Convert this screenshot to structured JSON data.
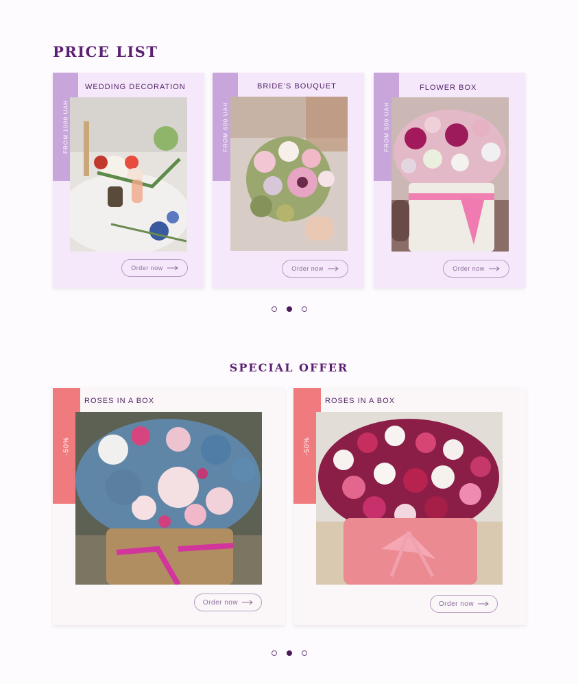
{
  "price_list": {
    "title": "PRICE LIST",
    "cards": [
      {
        "title": "WEDDING DECORATION",
        "price_tag": "FROM 1000 UAH",
        "button": "Order now"
      },
      {
        "title": "BRIDE’S BOUQUET",
        "price_tag": "FROM 600 UAH",
        "button": "Order now"
      },
      {
        "title": "FLOWER BOX",
        "price_tag": "FROM 500 UAH",
        "button": "Order now"
      }
    ],
    "pagination": {
      "count": 3,
      "active": 2
    }
  },
  "special_offer": {
    "title": "SPECIAL OFFER",
    "cards": [
      {
        "title": "ROSES IN A BOX",
        "discount": "-50%",
        "button": "Order now"
      },
      {
        "title": "ROSES IN A BOX",
        "discount": "-50%",
        "button": "Order now"
      }
    ],
    "pagination": {
      "count": 3,
      "active": 2
    }
  },
  "icons": {
    "order_arrow": "arrow-right-icon",
    "carousel_dot": "dot-icon"
  },
  "colors": {
    "title": "#5b2072",
    "price_card_bg": "#f6e8fb",
    "price_tag_bg": "#c8a6db",
    "discount_tag_bg": "#f07b7f",
    "offer_card_bg": "#fbf7f9",
    "active_dot": "#4a1a5a"
  }
}
